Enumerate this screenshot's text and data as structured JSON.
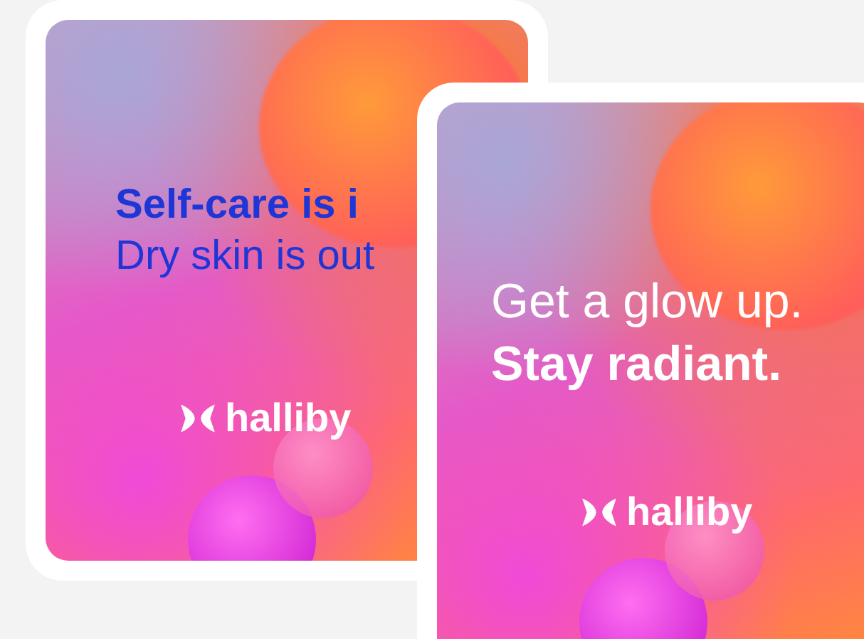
{
  "cards": [
    {
      "kind": "navy",
      "headline": "Self-care is i",
      "subline": "Dry skin is out",
      "logo": "halliby"
    },
    {
      "kind": "light",
      "headline": "Get a glow up.",
      "subline": "Stay radiant.",
      "logo": "halliby"
    }
  ]
}
